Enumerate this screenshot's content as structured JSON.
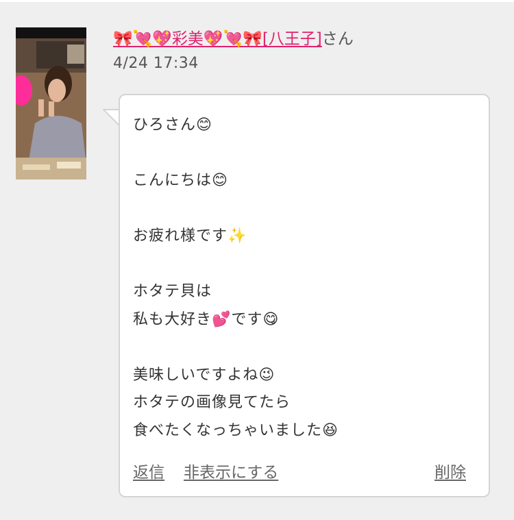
{
  "sender": {
    "name": "🎀💘💖彩美💖💘🎀[八王子]",
    "suffix": "さん"
  },
  "timestamp": "4/24 17:34",
  "message": {
    "text": "ひろさん😊\n\nこんにちは😊\n\nお疲れ様です✨\n\nホタテ貝は\n私も大好き💕です😋\n\n美味しいですよね😉\nホタテの画像見てたら\n食べたくなっちゃいました😆"
  },
  "actions": {
    "reply": "返信",
    "hide": "非表示にする",
    "delete": "削除"
  },
  "colors": {
    "name_link": "#e0216e",
    "background": "#efefef",
    "bubble": "#ffffff"
  }
}
